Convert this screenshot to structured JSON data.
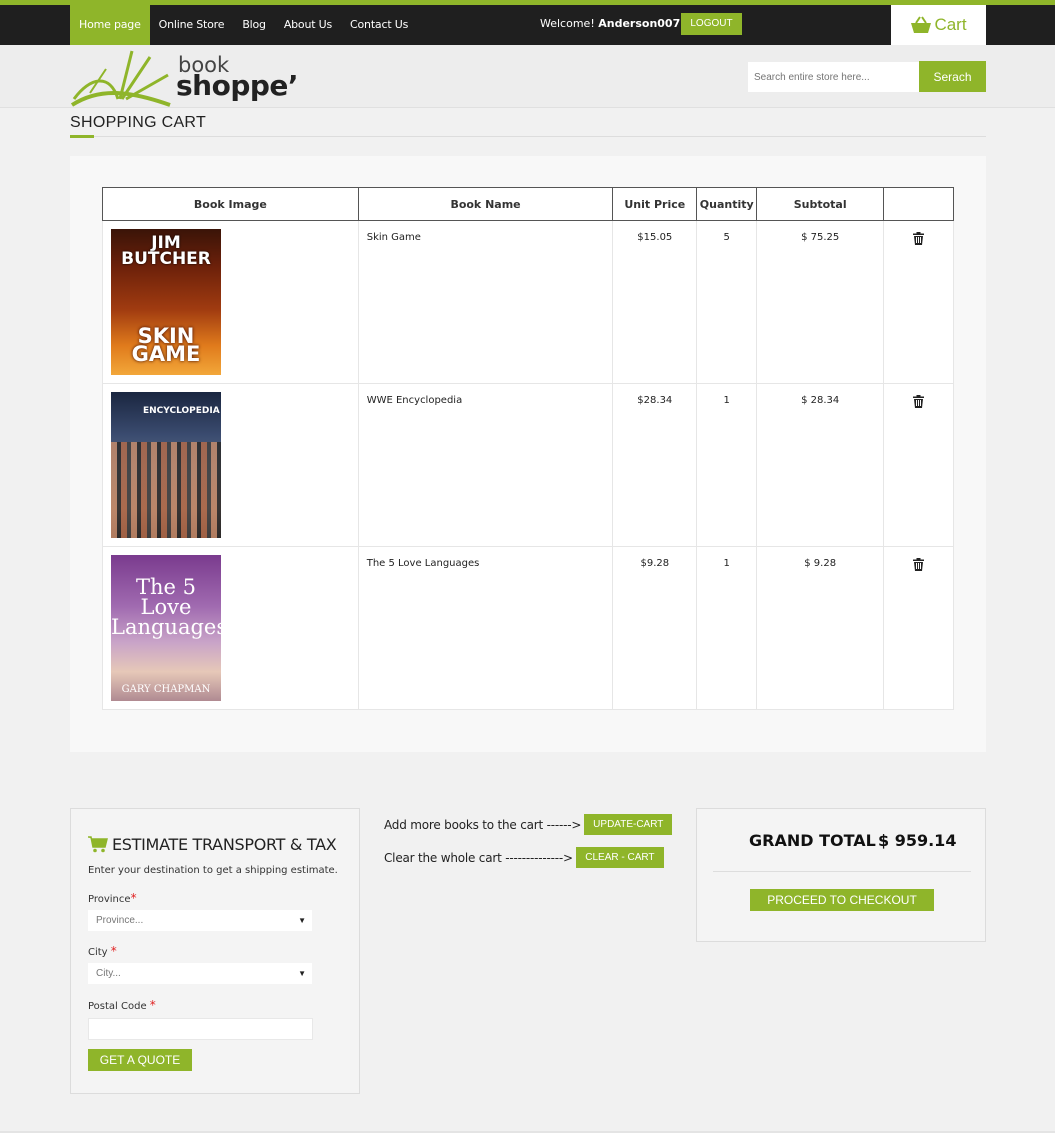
{
  "nav": {
    "items": [
      "Home page",
      "Online Store",
      "Blog",
      "About Us",
      "Contact Us"
    ],
    "active_index": 0,
    "welcome_prefix": "Welcome!",
    "username": "Anderson007",
    "logout_label": "LOGOUT",
    "cart_label": "Cart"
  },
  "header": {
    "logo_line1": "book",
    "logo_line2": "shoppe’",
    "search_placeholder": "Search entire store here...",
    "search_button": "Serach"
  },
  "page_title": "SHOPPING CART",
  "cart": {
    "columns": [
      "Book Image",
      "Book Name",
      "Unit Price",
      "Quantity",
      "Subtotal",
      ""
    ],
    "rows": [
      {
        "name": "Skin Game",
        "unit_price": "$15.05",
        "quantity": "5",
        "subtotal": "$ 75.25",
        "cover_author": "JIM BUTCHER",
        "cover_title": "SKIN GAME"
      },
      {
        "name": "WWE Encyclopedia",
        "unit_price": "$28.34",
        "quantity": "1",
        "subtotal": "$ 28.34",
        "cover_title": "ENCYCLOPEDIA"
      },
      {
        "name": "The 5 Love Languages",
        "unit_price": "$9.28",
        "quantity": "1",
        "subtotal": "$ 9.28",
        "cover_title": "The 5 Love Languages",
        "cover_author": "GARY CHAPMAN"
      }
    ]
  },
  "estimate": {
    "title": "ESTIMATE TRANSPORT & TAX",
    "subtitle": "Enter your destination to get a shipping estimate.",
    "province_label": "Province",
    "province_value": "Province...",
    "city_label": "City",
    "city_value": "City...",
    "postal_label": "Postal Code",
    "quote_button": "GET A QUOTE"
  },
  "actions": {
    "update_text": "Add more books to the cart ------>",
    "update_button": "UPDATE-CART",
    "clear_text": "Clear the whole cart -------------->",
    "clear_button": "CLEAR - CART"
  },
  "totals": {
    "label": "GRAND TOTAL",
    "value": "$ 959.14",
    "checkout_button": "PROCEED TO CHECKOUT"
  },
  "colors": {
    "accent": "#8fb52a",
    "nav_bg": "#1f1f1f"
  }
}
